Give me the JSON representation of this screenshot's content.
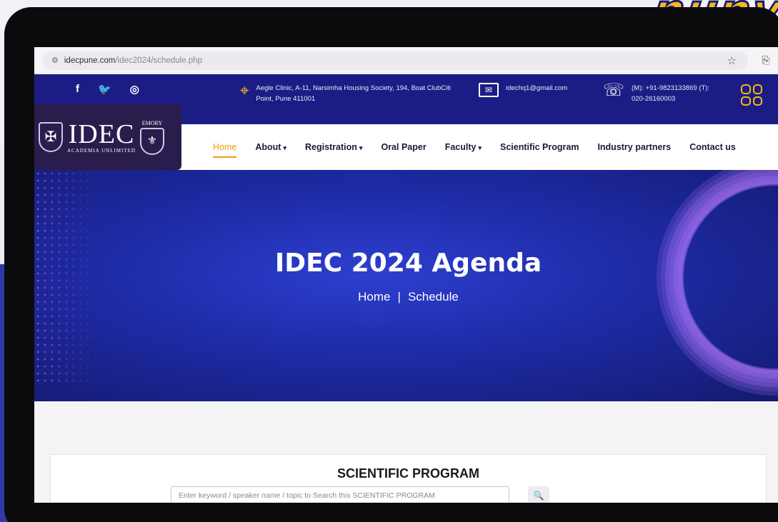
{
  "brand_mark": "nuny",
  "browser": {
    "url_domain": "idecpune.com",
    "url_path": "/idec2024/schedule.php",
    "tune_icon": "site-settings-icon",
    "star_icon": "bookmark-star-icon",
    "ext_icon": "extensions-icon"
  },
  "topbar": {
    "social": [
      "f",
      "🐦",
      "◎"
    ],
    "address": "Aegle Clinic, A-11, Narsimha Housing Society, 194, Boat ClubCiti Point, Pune 411001",
    "email": "idechq1@gmail.com",
    "phone": "(M): +91-9823133869 (T): 020-26160003",
    "colors": {
      "bar": "#1c1d84",
      "accent": "#f6b718"
    }
  },
  "logo": {
    "text": "IDEC",
    "tagline": "ACADEMIA UNLIMITED",
    "partner": "EMORY"
  },
  "nav": {
    "items": [
      {
        "label": "Home",
        "active": true,
        "dropdown": false
      },
      {
        "label": "About",
        "active": false,
        "dropdown": true
      },
      {
        "label": "Registration",
        "active": false,
        "dropdown": true
      },
      {
        "label": "Oral Paper",
        "active": false,
        "dropdown": false
      },
      {
        "label": "Faculty",
        "active": false,
        "dropdown": true
      },
      {
        "label": "Scientific Program",
        "active": false,
        "dropdown": false
      },
      {
        "label": "Industry partners",
        "active": false,
        "dropdown": false
      },
      {
        "label": "Contact us",
        "active": false,
        "dropdown": false
      }
    ],
    "active_color": "#f39c12"
  },
  "hero": {
    "title": "IDEC 2024 Agenda",
    "breadcrumb_home": "Home",
    "breadcrumb_sep": "|",
    "breadcrumb_current": "Schedule"
  },
  "program": {
    "heading": "SCIENTIFIC PROGRAM",
    "search_placeholder": "Enter keyword / speaker name / topic to Search this SCIENTIFIC PROGRAM",
    "search_icon": "search-icon"
  }
}
